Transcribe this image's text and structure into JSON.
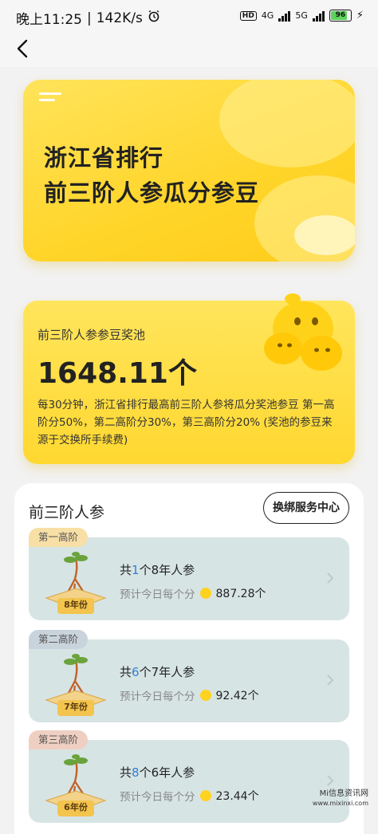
{
  "status_bar": {
    "time": "晚上11:25",
    "network_speed": "142K/s",
    "hd_label": "HD",
    "net_4g": "4G",
    "net_5g": "5G",
    "battery": "96"
  },
  "hero": {
    "title_line1": "浙江省排行",
    "title_line2": "前三阶人参瓜分参豆"
  },
  "pool": {
    "label": "前三阶人参参豆奖池",
    "amount": "1648.11个",
    "description": "每30分钟，浙江省排行最高前三阶人参将瓜分奖池参豆 第一高阶分50%，第二高阶分30%，第三高阶分20% (奖池的参豆来源于交换所手续费)"
  },
  "list": {
    "title": "前三阶人参",
    "bind_button": "换绑服务中心",
    "tiers": [
      {
        "tag": "第一高阶",
        "prefix": "共",
        "count": "1",
        "suffix": "个8年人参",
        "estimate": "预计今日每个分",
        "amount": "887.28个",
        "badge": "8年份",
        "tag_color": "#f7dfa6"
      },
      {
        "tag": "第二高阶",
        "prefix": "共",
        "count": "6",
        "suffix": "个7年人参",
        "estimate": "预计今日每个分",
        "amount": "92.42个",
        "badge": "7年份",
        "tag_color": "#c9d3dc"
      },
      {
        "tag": "第三高阶",
        "prefix": "共",
        "count": "8",
        "suffix": "个6年人参",
        "estimate": "预计今日每个分",
        "amount": "23.44个",
        "badge": "6年份",
        "tag_color": "#efcfc2"
      }
    ]
  },
  "watermark": {
    "line1": "Mi信息资讯网",
    "line2": "www.mixinxi.com"
  },
  "colors": {
    "accent_yellow": "#ffd52a",
    "count_blue": "#2f7fd9",
    "tier_bg": "#d7e4e4"
  }
}
